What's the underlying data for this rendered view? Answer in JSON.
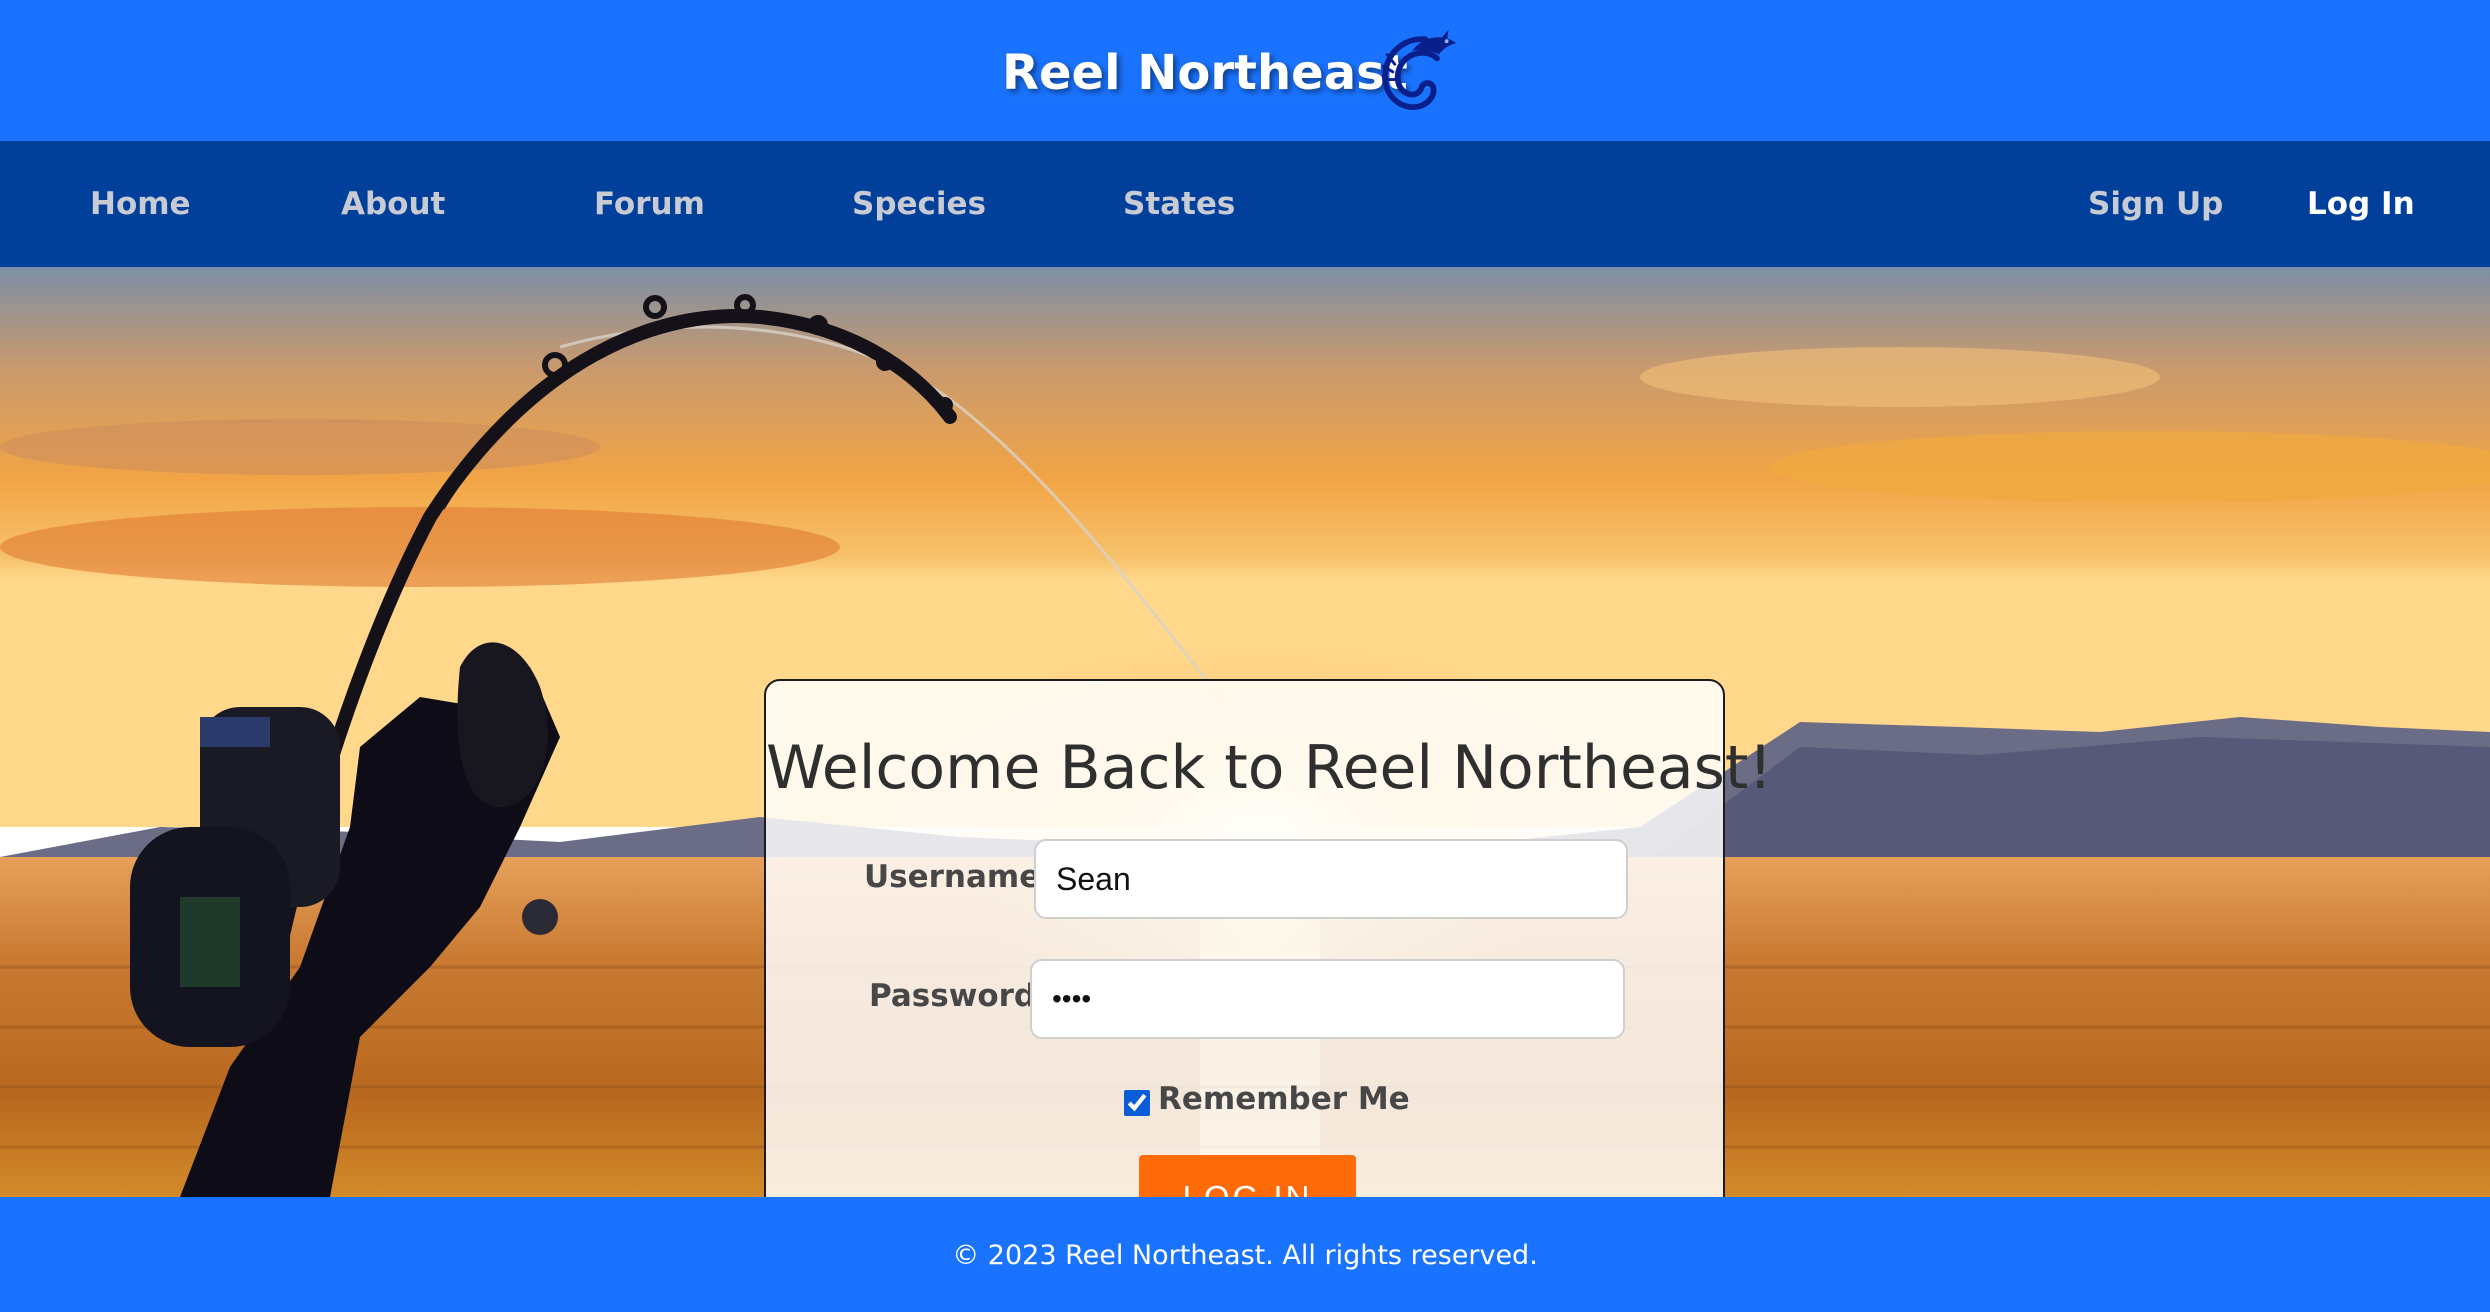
{
  "header": {
    "site_title": "Reel Northeast",
    "logo_icon": "fish-hook-icon",
    "background_color": "#1a73ff"
  },
  "nav": {
    "background_color": "#003f9a",
    "items": [
      {
        "label": "Home"
      },
      {
        "label": "About"
      },
      {
        "label": "Forum"
      },
      {
        "label": "Species"
      },
      {
        "label": "States"
      }
    ],
    "auth_items": [
      {
        "label": "Sign Up"
      },
      {
        "label": "Log In",
        "active": true
      }
    ]
  },
  "login_form": {
    "heading": "Welcome Back to Reel Northeast!",
    "username_label": "Username:",
    "username_value": "Sean",
    "password_label": "Password:",
    "password_value": "••••",
    "remember_label": "Remember Me",
    "remember_checked": true,
    "submit_label": "LOG IN",
    "submit_color": "#ff6b08"
  },
  "footer": {
    "copyright": "© 2023 Reel Northeast. All rights reserved."
  }
}
